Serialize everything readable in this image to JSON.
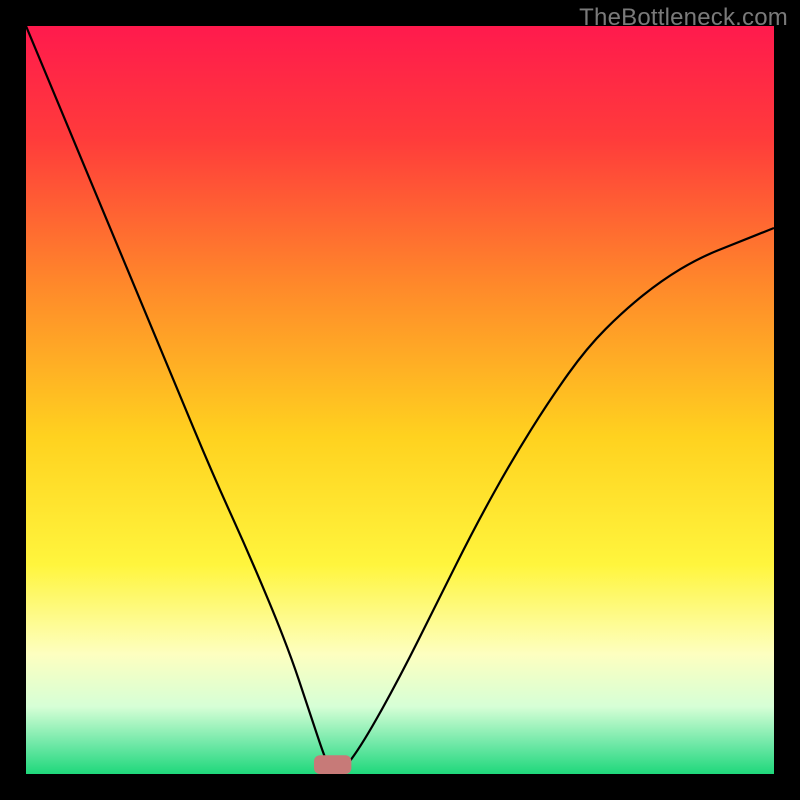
{
  "watermark": "TheBottleneck.com",
  "chart_data": {
    "type": "line",
    "title": "",
    "xlabel": "",
    "ylabel": "",
    "xlim": [
      0,
      100
    ],
    "ylim": [
      0,
      100
    ],
    "grid": false,
    "legend": "none",
    "annotations": [],
    "background_gradient_stops": [
      {
        "offset": 0.0,
        "color": "#ff1a4d"
      },
      {
        "offset": 0.15,
        "color": "#ff3b3b"
      },
      {
        "offset": 0.35,
        "color": "#ff8a2a"
      },
      {
        "offset": 0.55,
        "color": "#ffd21f"
      },
      {
        "offset": 0.72,
        "color": "#fff53d"
      },
      {
        "offset": 0.84,
        "color": "#fdffc0"
      },
      {
        "offset": 0.91,
        "color": "#d6ffd6"
      },
      {
        "offset": 0.96,
        "color": "#6fe8a7"
      },
      {
        "offset": 1.0,
        "color": "#1fd87b"
      }
    ],
    "series": [
      {
        "name": "bottleneck-curve",
        "color": "#000000",
        "x": [
          0,
          5,
          10,
          15,
          20,
          25,
          30,
          35,
          38,
          40,
          41,
          42,
          45,
          50,
          55,
          60,
          65,
          70,
          75,
          80,
          85,
          90,
          95,
          100
        ],
        "values": [
          100,
          88,
          76,
          64,
          52,
          40,
          29,
          17,
          8,
          2,
          0,
          0,
          4,
          13,
          23,
          33,
          42,
          50,
          57,
          62,
          66,
          69,
          71,
          73
        ]
      }
    ],
    "marker": {
      "x": 41,
      "y": 0,
      "width": 5,
      "height": 2.5,
      "color": "#c77a78"
    }
  }
}
